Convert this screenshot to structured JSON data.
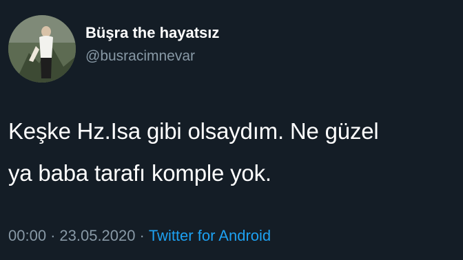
{
  "user": {
    "display_name": "Büşra the hayatsız",
    "handle": "@busracimnevar",
    "avatar_icon": "profile-photo-avatar"
  },
  "tweet": {
    "lines": [
      "Keşke Hz.Isa gibi olsaydım. Ne güzel",
      "ya baba tarafı komple yok."
    ],
    "time": "00:00",
    "separator": "·",
    "date": "23.05.2020",
    "source": "Twitter for Android"
  },
  "colors": {
    "background": "#141d26",
    "text": "#ffffff",
    "muted": "#8899a6",
    "link": "#1da1f2"
  }
}
